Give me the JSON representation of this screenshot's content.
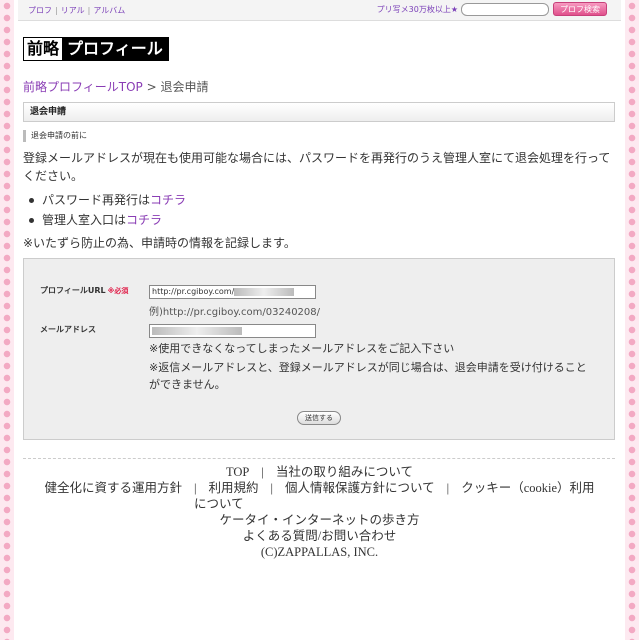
{
  "topbar": {
    "nav": [
      "プロフ",
      "リアル",
      "アルバム"
    ],
    "search_caption": "プリ写メ30万枚以上★",
    "search_placeholder": "",
    "search_button": "プロフ検索"
  },
  "logo": {
    "part1": "前略",
    "part2": "プロフィール"
  },
  "breadcrumb": {
    "home": "前略プロフィールTOP",
    "separator": " > ",
    "current": "退会申請"
  },
  "section_title": "退会申請",
  "sub_title": "退会申請の前に",
  "intro": "登録メールアドレスが現在も使用可能な場合には、パスワードを再発行のうえ管理人室にて退会処理を行ってください。",
  "bullets": [
    {
      "text": "パスワード再発行は",
      "link": "コチラ"
    },
    {
      "text": "管理人室入口は",
      "link": "コチラ"
    }
  ],
  "notice": "※いたずら防止の為、申請時の情報を記録します。",
  "form": {
    "url_label": "プロフィールURL",
    "required": "※必須",
    "url_value": "http://pr.cgiboy.com/",
    "url_example": "例)http://pr.cgiboy.com/03240208/",
    "mail_label": "メールアドレス",
    "mail_value": "",
    "mail_note1": "※使用できなくなってしまったメールアドレスをご記入下さい",
    "mail_note2": "※返信メールアドレスと、登録メールアドレスが同じ場合は、退会申請を受け付けることができません。",
    "submit": "送信する"
  },
  "footer": {
    "top": "TOP",
    "sep": "|",
    "efforts": "当社の取り組みについて",
    "policy": "健全化に資する運用方針",
    "terms": "利用規約",
    "privacy": "個人情報保護方針について",
    "cookie": "クッキー（cookie）利用",
    "cookie2": "について",
    "keitai": "ケータイ・インターネットの歩き方",
    "faq": "よくある質問/お問い合わせ",
    "copyright": "(C)ZAPPALLAS, INC."
  }
}
